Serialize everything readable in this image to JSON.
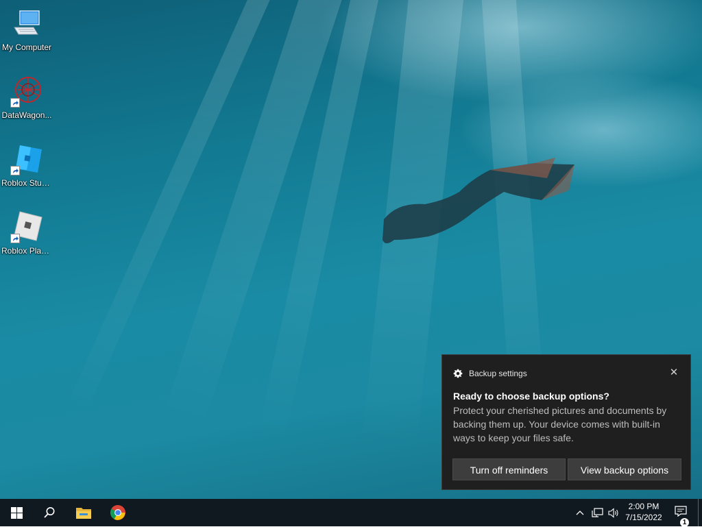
{
  "desktop": {
    "icons": [
      {
        "label": "My Computer",
        "icon": "monitor-icon"
      },
      {
        "label": "DataWagon...",
        "icon": "datawagon-logo-icon"
      },
      {
        "label": "Roblox Studio",
        "icon": "roblox-studio-icon"
      },
      {
        "label": "Roblox Player",
        "icon": "roblox-player-icon"
      }
    ]
  },
  "notification": {
    "app_name": "Backup settings",
    "app_icon": "gear-icon",
    "title": "Ready to choose backup options?",
    "body": "Protect your cherished pictures and documents by backing them up. Your device comes with built-in ways to keep your files safe.",
    "close_icon": "close-icon",
    "buttons": {
      "turn_off": "Turn off reminders",
      "view_options": "View backup options"
    }
  },
  "taskbar": {
    "start_icon": "windows-start-icon",
    "search_icon": "search-icon",
    "pinned": [
      "file-explorer-icon",
      "chrome-icon"
    ],
    "tray": {
      "icons": [
        "chevron-up-icon",
        "network-icon",
        "volume-icon"
      ],
      "time": "2:00 PM",
      "date": "7/15/2022",
      "notification_count": "1"
    }
  },
  "colors": {
    "toast_bg": "#1f1f1f",
    "toast_button": "#3d3d3d",
    "taskbar_bg": "#101820",
    "wallpaper_water": "#1a8ba4"
  }
}
